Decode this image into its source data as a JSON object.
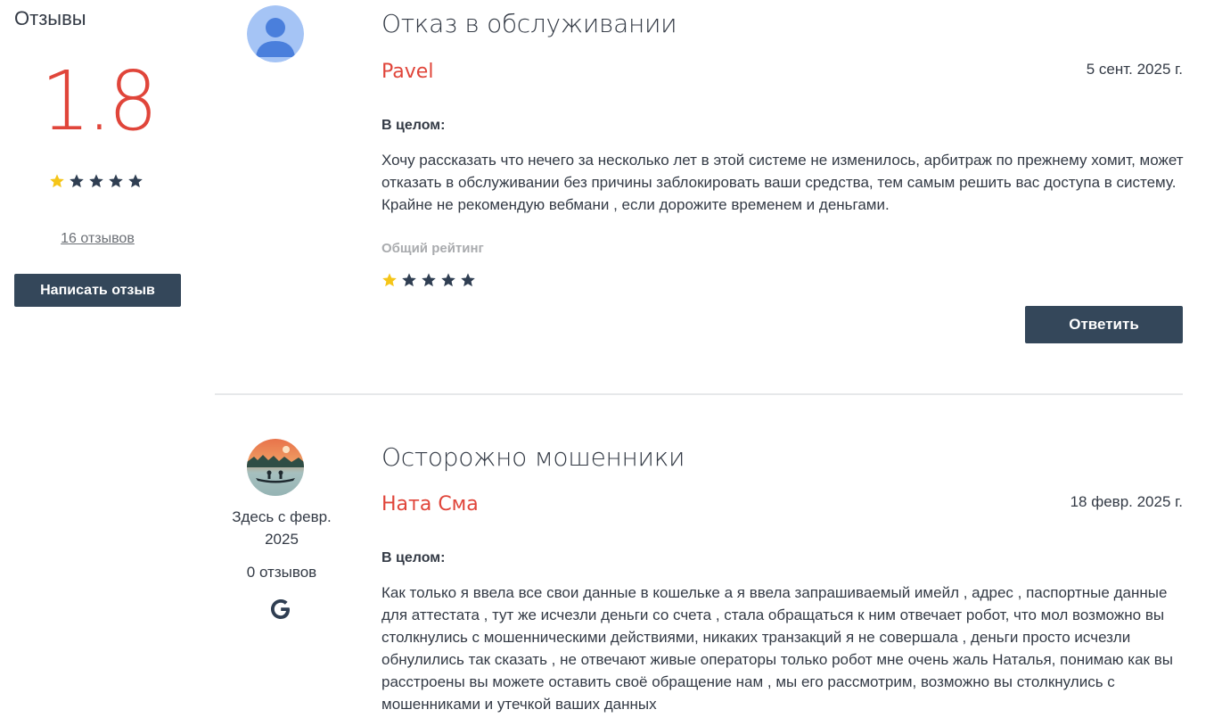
{
  "sidebar": {
    "title": "Отзывы",
    "average_rating": "1.8",
    "rating_value": 1,
    "rating_max": 5,
    "reviews_link": "16 отзывов",
    "write_button": "Написать отзыв"
  },
  "colors": {
    "accent": "#e0453a",
    "button": "#34475a",
    "star_filled": "#f5c518",
    "star_empty": "#2f3e52"
  },
  "reviews": [
    {
      "title": "Отказ в обслуживании",
      "author": "Pavel",
      "date": "5 сент. 2025 г.",
      "section_label": "В целом:",
      "text": "Хочу рассказать что нечего за несколько лет в этой системе не изменилось, арбитраж по прежнему хомит, может отказать в обслуживании без причины заблокировать ваши средства, тем самым решить вас доступа в систему. Крайне не рекомендую вебмани , если дорожите временем и деньгами.",
      "rating_label": "Общий рейтинг",
      "rating_value": 1,
      "reply_button": "Ответить",
      "avatar_icon": "default-user-icon"
    },
    {
      "title": "Осторожно мошенники",
      "author": "Ната Сма",
      "date": "18 февр. 2025 г.",
      "section_label": "В целом:",
      "text": "Как только я ввела все свои данные в кошельке а я ввела запрашиваемый имейл , адрес , паспортные данные для аттестата , тут же исчезли деньги со счета , стала обращаться к ним отвечает робот, что мол возможно вы столкнулись с мошенническими действиями, никаких транзакций я не совершала , деньги просто исчезли обнулились так сказать , не отвечают живые операторы только робот мне очень жаль Наталья, понимаю как вы расстроены вы можете оставить своё обращение нам , мы его рассмотрим, возможно вы столкнулись с мошенниками и утечкой ваших данных",
      "member_since": "Здесь с февр. 2025",
      "review_count": "0 отзывов",
      "source_icon": "google-icon",
      "avatar_icon": "landscape-photo-avatar"
    }
  ]
}
